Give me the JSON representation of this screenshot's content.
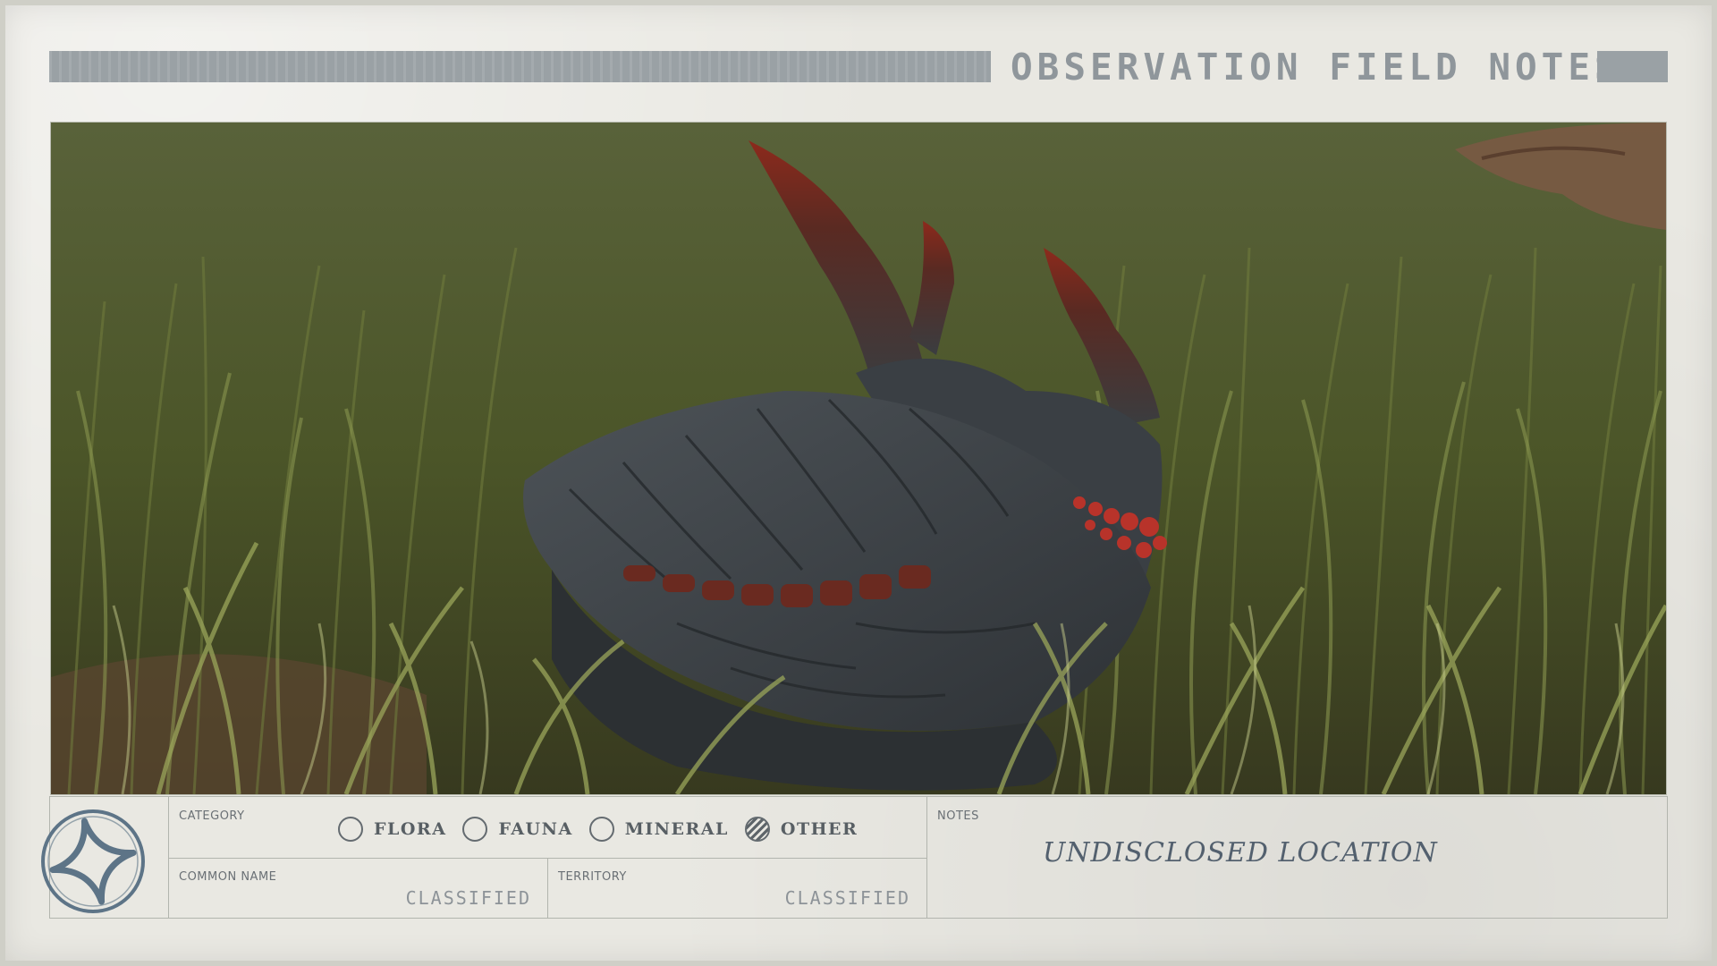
{
  "header": {
    "title": "OBSERVATION FIELD NOTES"
  },
  "photo": {
    "subject": "creature-shell-icon"
  },
  "panel": {
    "category": {
      "label": "CATEGORY",
      "options": [
        {
          "label": "FLORA",
          "selected": false
        },
        {
          "label": "FAUNA",
          "selected": false
        },
        {
          "label": "MINERAL",
          "selected": false
        },
        {
          "label": "OTHER",
          "selected": true
        }
      ]
    },
    "common_name": {
      "label": "COMMON NAME",
      "value": "CLASSIFIED"
    },
    "territory": {
      "label": "TERRITORY",
      "value": "CLASSIFIED"
    },
    "notes": {
      "label": "NOTES",
      "text": "UNDISCLOSED LOCATION"
    }
  },
  "colors": {
    "paper": "#e9e8e2",
    "header_bar": "#9aa1a5",
    "ink": "#585f64",
    "handwriting": "#53606e",
    "emblem": "#5d7487"
  },
  "icons": {
    "emblem": "four-point-star-emblem-icon"
  }
}
